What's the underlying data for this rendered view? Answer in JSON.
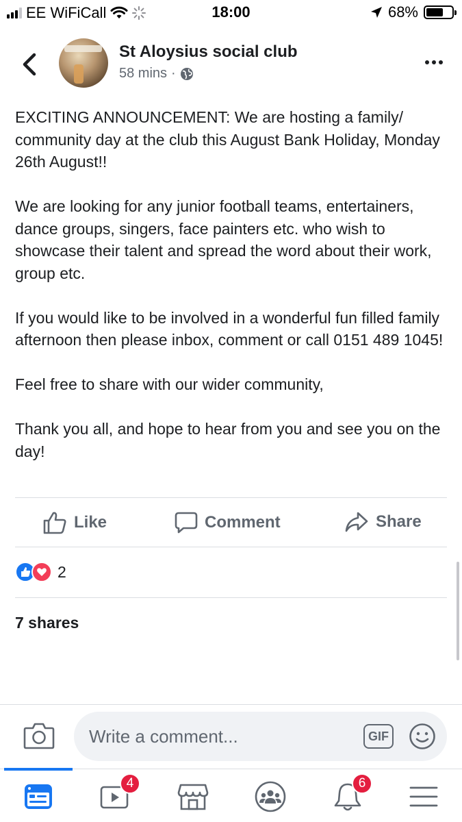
{
  "status_bar": {
    "carrier": "EE WiFiCall",
    "time": "18:00",
    "battery": "68%",
    "battery_level": 0.68,
    "icons": [
      "signal-icon",
      "wifi-icon",
      "activity-spinner-icon",
      "location-arrow-icon",
      "battery-icon"
    ]
  },
  "header": {
    "page_name": "St Aloysius social club",
    "time_ago": "58 mins",
    "separator": "·",
    "privacy_icon": "globe-icon"
  },
  "post": {
    "paragraphs": [
      "EXCITING ANNOUNCEMENT: We are hosting a family/ community day at the club this August Bank Holiday, Monday 26th August!!",
      "We are looking for any junior football teams, entertainers, dance groups, singers, face painters etc. who wish to showcase their talent and spread the word about their work, group etc.",
      "If you would like to be involved in a wonderful fun filled family afternoon then please inbox, comment or call 0151 489 1045!",
      "Feel free to share with our wider community,",
      "Thank you all, and hope to hear from you and see you on the day!"
    ]
  },
  "actions": {
    "like": "Like",
    "comment": "Comment",
    "share": "Share"
  },
  "reactions": {
    "count": "2",
    "types": [
      "like",
      "love"
    ]
  },
  "shares": "7 shares",
  "comment_bar": {
    "placeholder": "Write a comment...",
    "gif_label": "GIF"
  },
  "tab_bar": {
    "items": [
      {
        "name": "news-feed",
        "active": true,
        "badge": ""
      },
      {
        "name": "watch",
        "active": false,
        "badge": "4"
      },
      {
        "name": "marketplace",
        "active": false,
        "badge": ""
      },
      {
        "name": "groups",
        "active": false,
        "badge": ""
      },
      {
        "name": "notifications",
        "active": false,
        "badge": "6"
      },
      {
        "name": "menu",
        "active": false,
        "badge": ""
      }
    ]
  },
  "colors": {
    "accent": "#1877f2",
    "badge": "#e41e3f",
    "love": "#f33e58",
    "muted_text": "#606770"
  }
}
